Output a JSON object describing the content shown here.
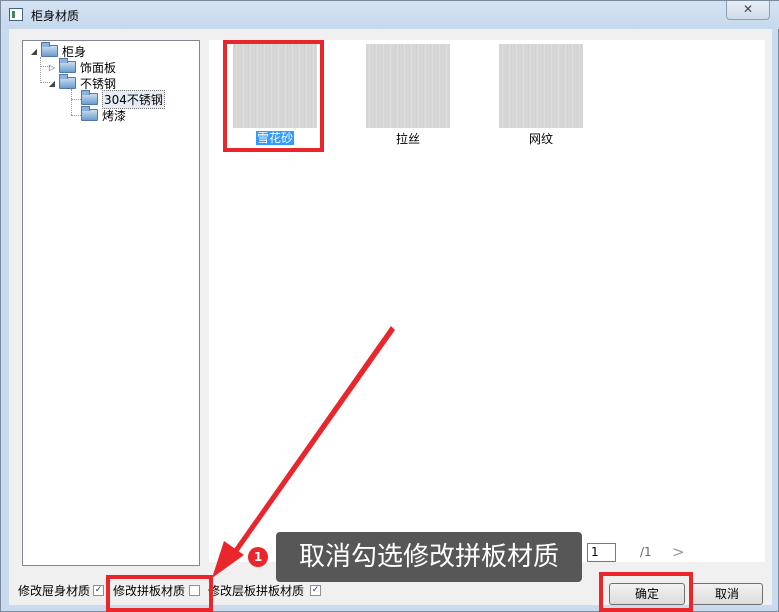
{
  "window": {
    "title": "柜身材质",
    "close_glyph": "✕"
  },
  "tree": {
    "root": {
      "label": "柜身",
      "expander": "◢"
    },
    "children": [
      {
        "label": "饰面板",
        "expander": "▷"
      },
      {
        "label": "不锈钢",
        "expander": "◢",
        "children": [
          {
            "label": "304不锈钢",
            "selected": true
          },
          {
            "label": "烤漆"
          }
        ]
      }
    ]
  },
  "gallery": {
    "items": [
      {
        "label": "雪花砂",
        "selected": true
      },
      {
        "label": "拉丝"
      },
      {
        "label": "网纹"
      }
    ]
  },
  "pager": {
    "current": "1",
    "total": "/1",
    "next": ">"
  },
  "checkboxes": [
    {
      "label": "修改屉身材质",
      "checked": true,
      "mark": "✓"
    },
    {
      "label": "修改拼板材质",
      "checked": false,
      "mark": ""
    },
    {
      "label": "修改层板拼板材质",
      "checked": true,
      "mark": "✓"
    }
  ],
  "buttons": {
    "ok": "确定",
    "cancel": "取消"
  },
  "annotation": {
    "badge": "1",
    "text": "取消勾选修改拼板材质"
  },
  "colors": {
    "highlight": "#e8262b",
    "selection": "#3399ff",
    "callout_bg": "#575757"
  }
}
